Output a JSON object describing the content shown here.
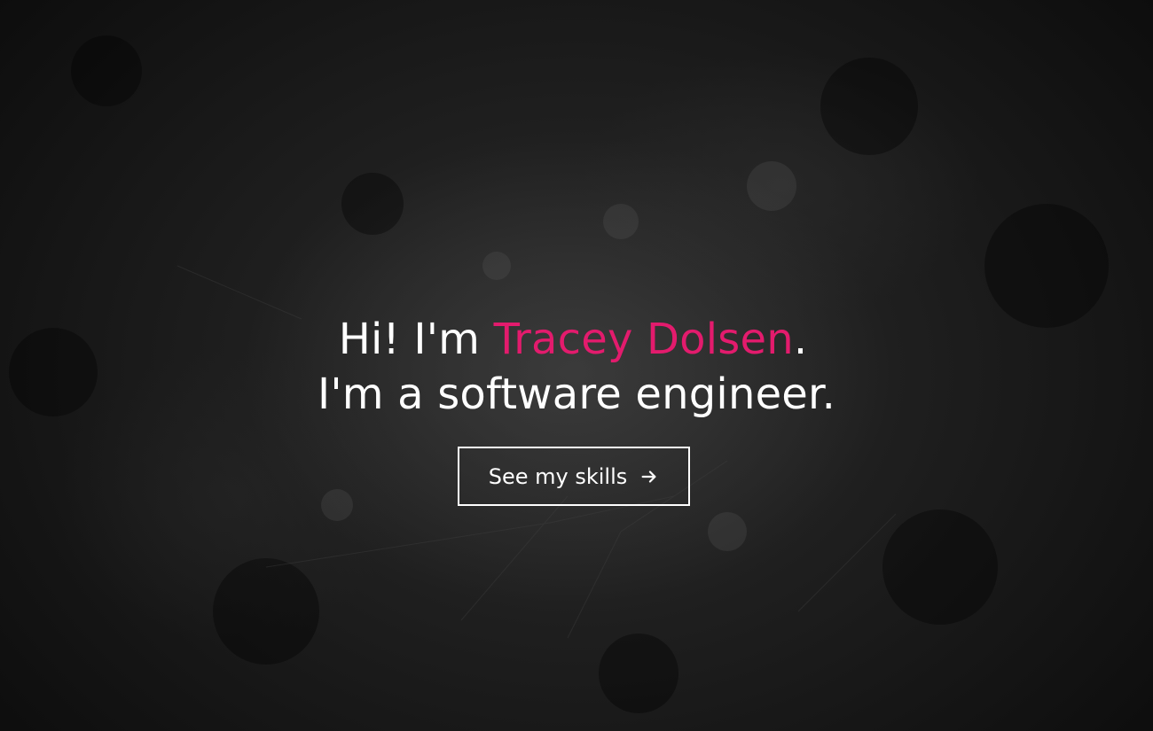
{
  "hero": {
    "greeting": "Hi! I'm",
    "name": "Tracey Dolsen",
    "period": ".",
    "tagline": "I'm a software engineer."
  },
  "cta": {
    "label": "See my skills",
    "icon": "arrow-right-icon"
  },
  "colors": {
    "accent": "#e31b6d",
    "text": "#ffffff",
    "background": "#1a1a1a"
  }
}
